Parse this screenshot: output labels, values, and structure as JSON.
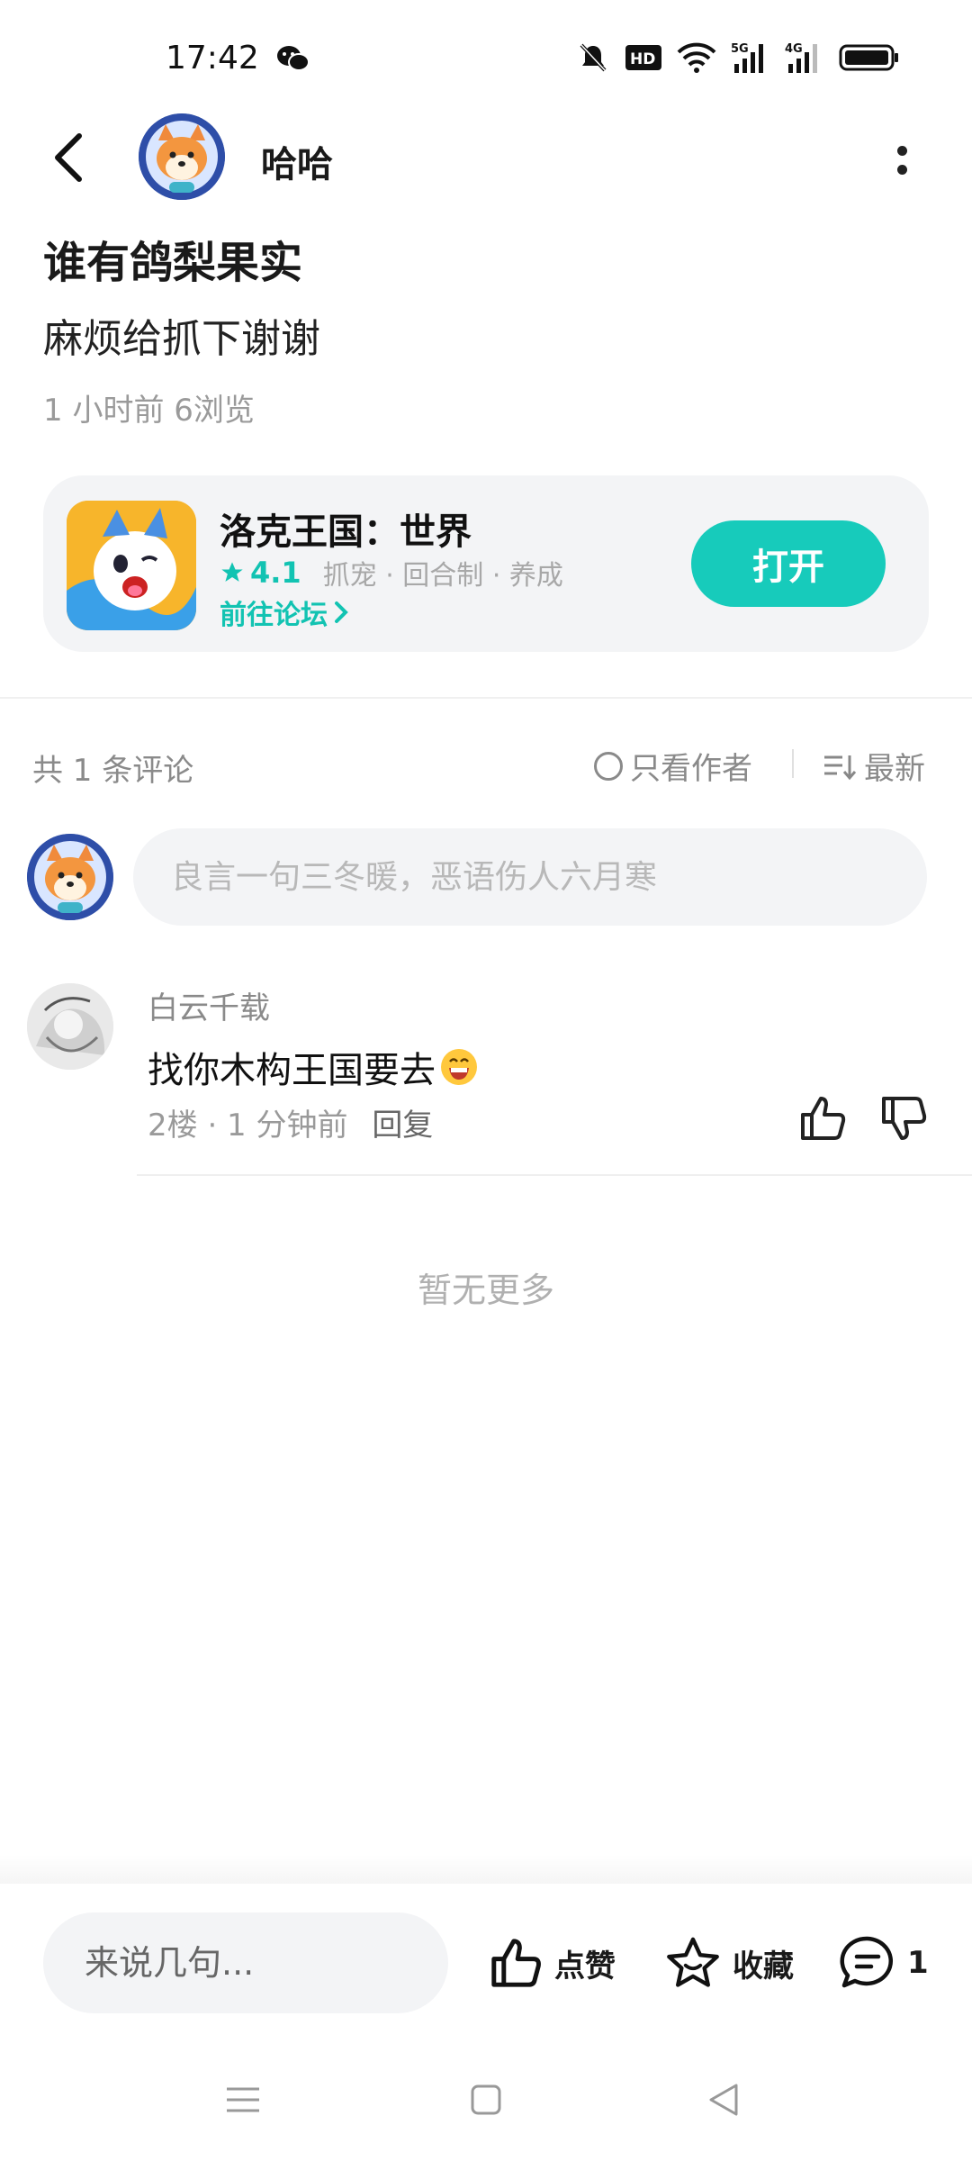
{
  "status_bar": {
    "time": "17:42"
  },
  "header": {
    "author_name": "哈哈"
  },
  "post": {
    "title": "谁有鸽梨果实",
    "body": "麻烦给抓下谢谢",
    "meta": "1 小时前  6浏览"
  },
  "game_card": {
    "name": "洛克王国：世界",
    "rating": "4.1",
    "tags": "抓宠 · 回合制 · 养成",
    "forum_link": "前往论坛",
    "open_label": "打开"
  },
  "comments": {
    "count_label": "共 1 条评论",
    "only_author_label": "只看作者",
    "sort_label": "最新",
    "input_placeholder": "良言一句三冬暖，恶语伤人六月寒",
    "items": [
      {
        "user": "白云千载",
        "text": "找你木构王国要去",
        "meta": "2楼 · 1 分钟前",
        "reply_label": "回复"
      }
    ],
    "no_more": "暂无更多"
  },
  "bottom_bar": {
    "input_placeholder": "来说几句...",
    "like_label": "点赞",
    "fav_label": "收藏",
    "comment_count": "1"
  },
  "colors": {
    "accent": "#17cbbb",
    "text_secondary": "#9a9a9a",
    "card_bg": "#f3f4f6"
  },
  "icons": [
    "back-icon",
    "more-icon",
    "star-icon",
    "chevron-right-icon",
    "circle-icon",
    "sort-icon",
    "thumb-up-icon",
    "thumb-down-icon",
    "star-outline-icon",
    "comment-icon"
  ]
}
